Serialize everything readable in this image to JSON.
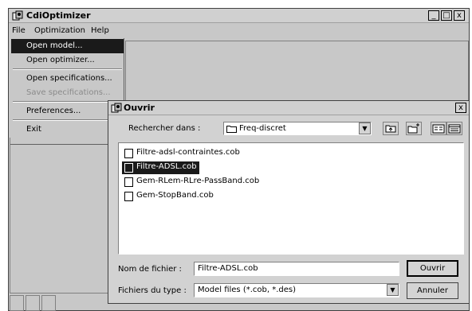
{
  "app": {
    "title": "CdiOptimizer",
    "window_controls": [
      "_",
      "□",
      "x"
    ]
  },
  "menubar": {
    "items": [
      {
        "label": "File"
      },
      {
        "label": "Optimization"
      },
      {
        "label": "Help"
      }
    ]
  },
  "file_menu": {
    "items": [
      {
        "label": "Open model...",
        "state": "highlighted"
      },
      {
        "label": "Open optimizer..."
      },
      {
        "label": "Open specifications..."
      },
      {
        "label": "Save specifications...",
        "state": "disabled"
      },
      {
        "label": "Preferences..."
      },
      {
        "label": "Exit"
      }
    ]
  },
  "dialog": {
    "title": "Ouvrir",
    "close": "x",
    "look_in_label": "Rechercher dans :",
    "look_in_value": "Freq-discret",
    "toolbar_icons": [
      "up-folder-icon",
      "new-folder-icon",
      "list-view-icon",
      "details-view-icon"
    ],
    "files": [
      {
        "name": "Filtre-adsl-contraintes.cob",
        "selected": false
      },
      {
        "name": "Filtre-ADSL.cob",
        "selected": true
      },
      {
        "name": "Gem-RLem-RLre-PassBand.cob",
        "selected": false
      },
      {
        "name": "Gem-StopBand.cob",
        "selected": false
      }
    ],
    "filename_label": "Nom de fichier :",
    "filename_value": "Filtre-ADSL.cob",
    "filetype_label": "Fichiers du type :",
    "filetype_value": "Model files (*.cob, *.des)",
    "open_button": "Ouvrir",
    "cancel_button": "Annuler"
  }
}
